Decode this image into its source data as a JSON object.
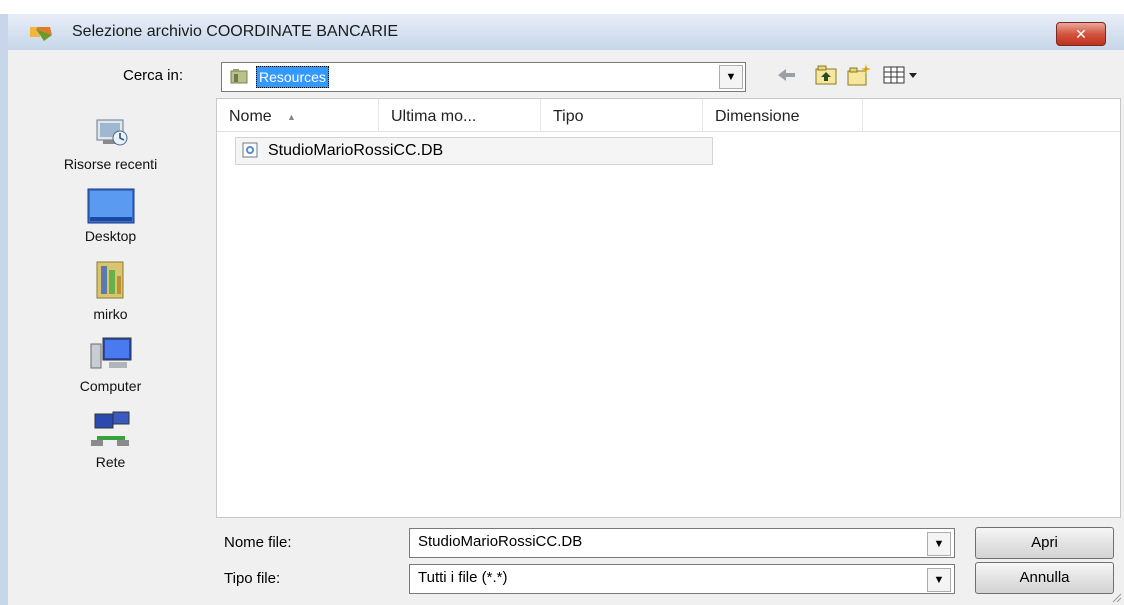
{
  "window": {
    "title": "Selezione archivio COORDINATE BANCARIE",
    "close_label": "✕"
  },
  "toolbar": {
    "look_in_label": "Cerca in:",
    "look_in_value": "Resources",
    "icons": [
      "back-arrow-icon",
      "up-folder-icon",
      "new-folder-icon",
      "views-menu-icon"
    ]
  },
  "places": [
    {
      "label": "Risorse recenti",
      "icon": "recent-places-icon"
    },
    {
      "label": "Desktop",
      "icon": "desktop-icon"
    },
    {
      "label": "mirko",
      "icon": "user-folder-icon"
    },
    {
      "label": "Computer",
      "icon": "computer-icon"
    },
    {
      "label": "Rete",
      "icon": "network-icon"
    }
  ],
  "file_list": {
    "columns": [
      "Nome",
      "Ultima mo...",
      "Tipo",
      "Dimensione"
    ],
    "files": [
      {
        "name": "StudioMarioRossiCC.DB",
        "icon": "database-file-icon"
      }
    ]
  },
  "footer": {
    "filename_label": "Nome file:",
    "filename_value": "StudioMarioRossiCC.DB",
    "filetype_label": "Tipo file:",
    "filetype_value": "Tutti i file (*.*)",
    "open_label": "Apri",
    "cancel_label": "Annulla"
  },
  "colors": {
    "selection": "#3399ff",
    "titlebar": "#d7e2f1",
    "close_button": "#c0301c"
  }
}
